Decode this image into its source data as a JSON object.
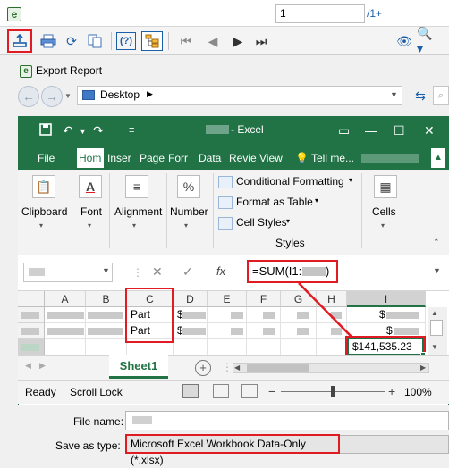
{
  "viewer": {
    "page_value": "1",
    "page_total": "/1+"
  },
  "dialog": {
    "title": "Export Report",
    "address_location": "Desktop",
    "file_name_label": "File name:",
    "save_as_type_label": "Save as type:",
    "save_as_type_value": "Microsoft Excel Workbook Data-Only (*.xlsx)"
  },
  "excel": {
    "title_suffix": " - Excel",
    "tabs": [
      "File",
      "Hom",
      "Inser",
      "Page",
      "Forr",
      "Data",
      "Revie",
      "View"
    ],
    "tell_me": "Tell me...",
    "ribbon": {
      "clipboard": "Clipboard",
      "font": "Font",
      "alignment": "Alignment",
      "number": "Number",
      "conditional_formatting": "Conditional Formatting",
      "format_as_table": "Format as Table",
      "cell_styles": "Cell Styles",
      "styles_group": "Styles",
      "cells": "Cells"
    },
    "formula": "=SUM(I1:I",
    "columns": [
      "A",
      "B",
      "C",
      "D",
      "E",
      "F",
      "G",
      "H",
      "I"
    ],
    "rows": [
      {
        "c": "Part",
        "d": "$",
        "i": "$"
      },
      {
        "c": "Part",
        "d": "$",
        "i": "$"
      }
    ],
    "selected_value": "$141,535.23",
    "sheet_tab": "Sheet1",
    "status_ready": "Ready",
    "status_scroll_lock": "Scroll Lock",
    "zoom": "100%"
  },
  "colors": {
    "excel_green": "#217346",
    "highlight_red": "#e01b24",
    "link_blue": "#1b5fab"
  }
}
